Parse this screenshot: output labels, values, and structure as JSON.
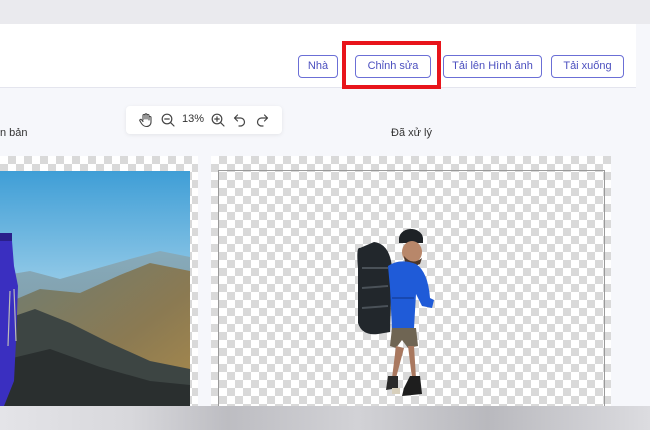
{
  "nav": {
    "home": "Nhà",
    "edit": "Chỉnh sửa",
    "upload": "Tải lên Hình ảnh",
    "download": "Tải xuống"
  },
  "toolbar": {
    "zoom": "13%",
    "icons": [
      "hand-icon",
      "zoom-out-icon",
      "zoom-in-icon",
      "undo-icon",
      "redo-icon"
    ]
  },
  "panels": {
    "original_label_partial": "n bản",
    "processed_label": "Đã xử lý"
  },
  "colors": {
    "accent": "#4b4fbf",
    "highlight": "#e8141b"
  }
}
